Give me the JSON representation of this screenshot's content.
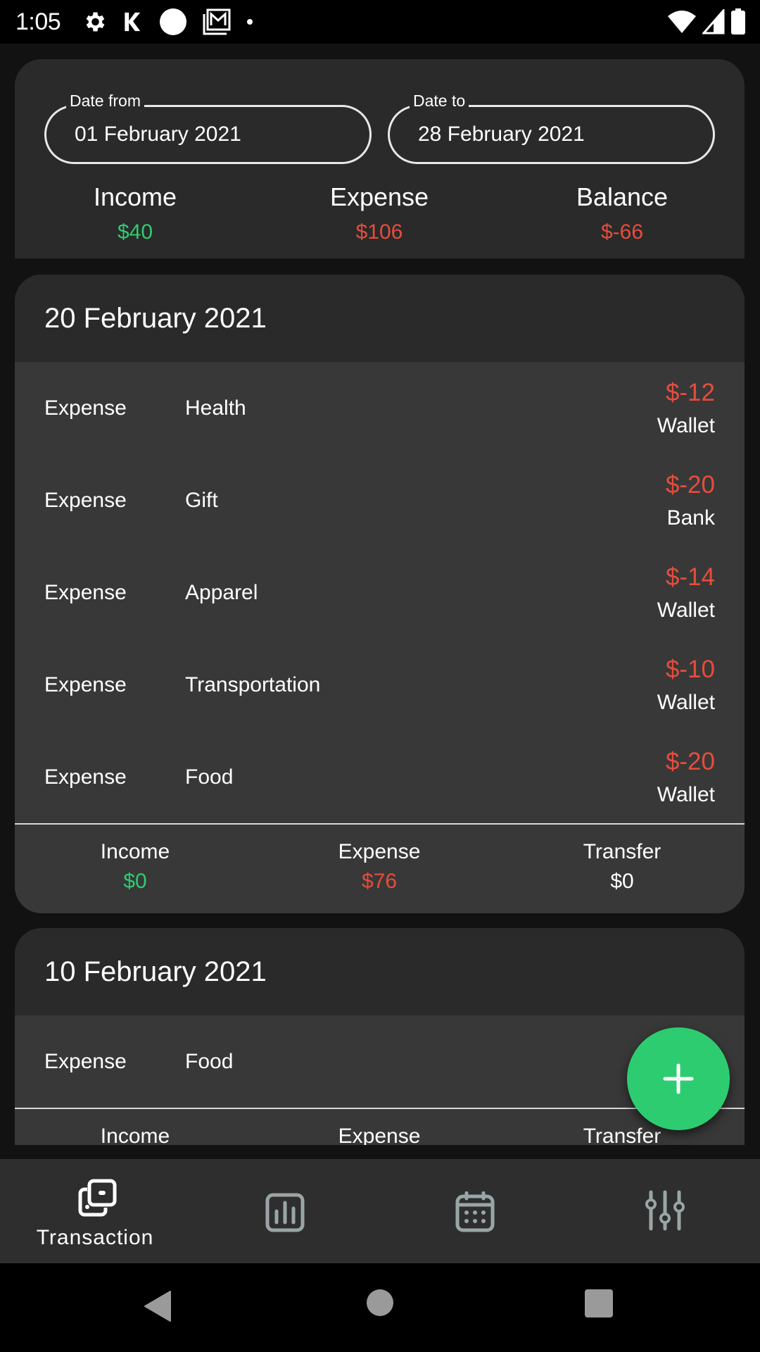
{
  "status_bar": {
    "time": "1:05",
    "left_icons": [
      "settings-gear-icon",
      "k-app-icon",
      "circle-app-icon",
      "gmail-icon",
      "dot-icon"
    ],
    "right_icons": [
      "wifi-icon",
      "cellular-signal-icon",
      "battery-icon"
    ]
  },
  "filter": {
    "date_from_label": "Date from",
    "date_from_value": "01 February 2021",
    "date_to_label": "Date to",
    "date_to_value": "28 February 2021"
  },
  "summary": {
    "income_label": "Income",
    "income_value": "$40",
    "expense_label": "Expense",
    "expense_value": "$106",
    "balance_label": "Balance",
    "balance_value": "$-66"
  },
  "groups": [
    {
      "date": "20 February 2021",
      "transactions": [
        {
          "type": "Expense",
          "category": "Health",
          "amount": "$-12",
          "account": "Wallet"
        },
        {
          "type": "Expense",
          "category": "Gift",
          "amount": "$-20",
          "account": "Bank"
        },
        {
          "type": "Expense",
          "category": "Apparel",
          "amount": "$-14",
          "account": "Wallet"
        },
        {
          "type": "Expense",
          "category": "Transportation",
          "amount": "$-10",
          "account": "Wallet"
        },
        {
          "type": "Expense",
          "category": "Food",
          "amount": "$-20",
          "account": "Wallet"
        }
      ],
      "footer": {
        "income_label": "Income",
        "income_value": "$0",
        "expense_label": "Expense",
        "expense_value": "$76",
        "transfer_label": "Transfer",
        "transfer_value": "$0"
      }
    },
    {
      "date": "10 February 2021",
      "transactions": [
        {
          "type": "Expense",
          "category": "Food"
        }
      ],
      "footer": {
        "income_label": "Income",
        "expense_label": "Expense",
        "transfer_label": "Transfer"
      }
    }
  ],
  "fab": {
    "icon": "plus-icon"
  },
  "bottom_nav": {
    "items": [
      {
        "label": "Transaction",
        "icon": "transaction-icon",
        "active": true
      },
      {
        "label": "",
        "icon": "chart-icon",
        "active": false
      },
      {
        "label": "",
        "icon": "calendar-icon",
        "active": false
      },
      {
        "label": "",
        "icon": "settings-sliders-icon",
        "active": false
      }
    ]
  },
  "system_nav": [
    "back",
    "home",
    "recents"
  ],
  "colors": {
    "income": "#2ecc71",
    "expense": "#e74c3c",
    "accent": "#2ecc71",
    "inactive_icon": "#9aa5a5"
  }
}
